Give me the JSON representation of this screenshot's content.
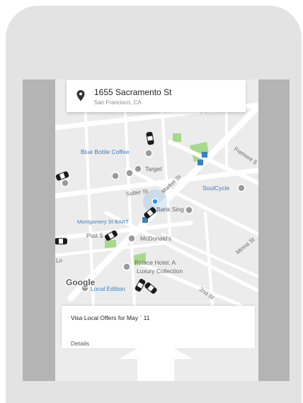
{
  "address": {
    "title": "1655 Sacramento St",
    "subtitle": "San Francisco, CA",
    "icon": "location-pin-icon"
  },
  "map": {
    "places": {
      "blue_bottle": "Blue Bottle Coffee",
      "target": "Target",
      "soulcycle": "SoulCycle",
      "bank": "Bank Sing",
      "montgomery": "Montgomery St BART",
      "mcdonalds": "McDonald's",
      "palace_line1": "Palace Hotel, A",
      "palace_line2": "Luxury Collection",
      "local_edition": "Local Edition"
    },
    "streets": {
      "pine": "Pine St",
      "sutter": "Sutter St",
      "market": "Market St",
      "fremont": "Fremont S",
      "post": "Post S",
      "minna": "Minna St",
      "second": "2nd St",
      "ln": "Ln"
    },
    "attribution": "Google",
    "colors": {
      "land": "#ececec",
      "roads": "#ffffff",
      "park": "#a8d98a",
      "poi_label": "#3a7fc1",
      "user_dot": "#3b8fd6"
    }
  },
  "offer": {
    "title": "Visa Local Offers for May ` 11",
    "subtitle": "Details"
  },
  "overlay": {
    "icon": "swipe-up-arrow-icon"
  }
}
